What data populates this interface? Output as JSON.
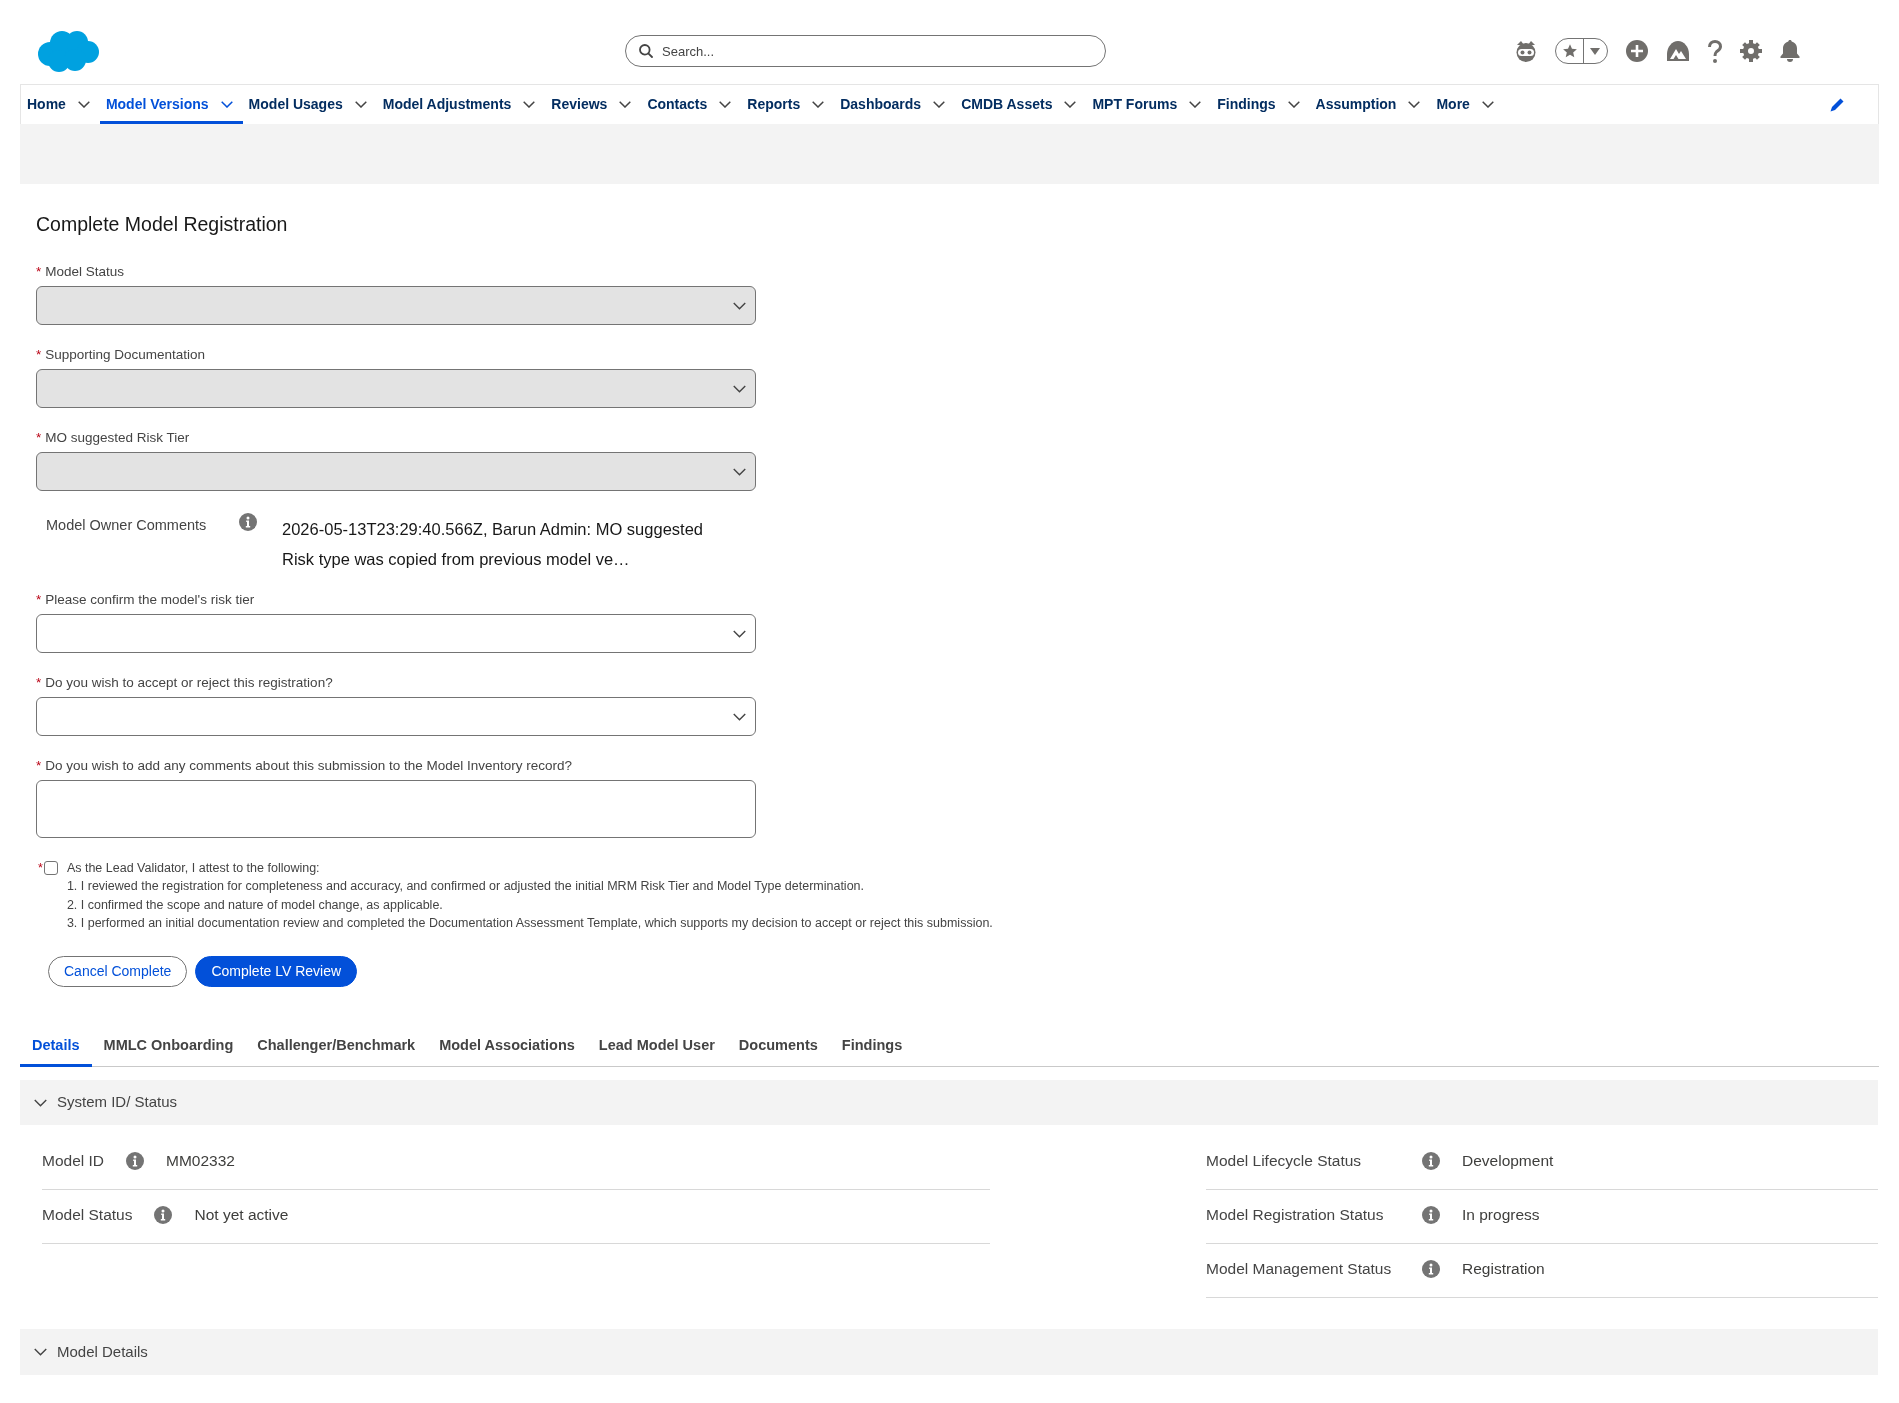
{
  "header": {
    "search": {
      "placeholder": "Search..."
    }
  },
  "nav": {
    "items": [
      {
        "label": "Home",
        "selected": false
      },
      {
        "label": "Model Versions",
        "selected": true
      },
      {
        "label": "Model Usages",
        "selected": false
      },
      {
        "label": "Model Adjustments",
        "selected": false
      },
      {
        "label": "Reviews",
        "selected": false
      },
      {
        "label": "Contacts",
        "selected": false
      },
      {
        "label": "Reports",
        "selected": false
      },
      {
        "label": "Dashboards",
        "selected": false
      },
      {
        "label": "CMDB Assets",
        "selected": false
      },
      {
        "label": "MPT Forums",
        "selected": false
      },
      {
        "label": "Findings",
        "selected": false
      },
      {
        "label": "Assumption",
        "selected": false
      },
      {
        "label": "More",
        "selected": false
      }
    ]
  },
  "form": {
    "title": "Complete Model Registration",
    "fields": [
      {
        "kind": "select",
        "required_mark": "*",
        "label": "Model Status",
        "disabled": true
      },
      {
        "kind": "select",
        "required_mark": "*",
        "label": "Supporting Documentation",
        "disabled": true
      },
      {
        "kind": "select",
        "required_mark": "*",
        "label": "MO suggested Risk Tier",
        "disabled": true
      },
      {
        "kind": "readonly",
        "label": "Model Owner Comments",
        "value": "2026-05-13T23:29:40.566Z, Barun Admin: MO suggested Risk type was copied from previous model ve…"
      },
      {
        "kind": "select",
        "required_mark": "*",
        "label": "Please confirm the model's risk tier",
        "disabled": false
      },
      {
        "kind": "select",
        "required_mark": "*",
        "label": "Do you wish to accept or reject this registration?",
        "disabled": false
      },
      {
        "kind": "textarea",
        "required_mark": "*",
        "label": "Do you wish to add any comments about this submission to the Model Inventory record?"
      }
    ],
    "attestation": {
      "required_mark": "*",
      "checked": false,
      "label": "As the Lead Validator, I attest to the following:",
      "items": [
        "1. I reviewed the registration for completeness and accuracy, and confirmed or adjusted the initial MRM Risk Tier and Model Type determination.",
        "2. I confirmed the scope and nature of model change, as applicable.",
        "3. I performed an initial documentation review and completed the Documentation Assessment Template, which supports my decision to accept or reject this submission."
      ]
    },
    "buttons": [
      {
        "label": "Cancel Complete",
        "kind": "outline"
      },
      {
        "label": "Complete LV Review",
        "kind": "brand"
      }
    ]
  },
  "tabs": [
    {
      "label": "Details",
      "selected": true
    },
    {
      "label": "MMLC Onboarding",
      "selected": false
    },
    {
      "label": "Challenger/Benchmark",
      "selected": false
    },
    {
      "label": "Model Associations",
      "selected": false
    },
    {
      "label": "Lead Model User",
      "selected": false
    },
    {
      "label": "Documents",
      "selected": false
    },
    {
      "label": "Findings",
      "selected": false
    }
  ],
  "sections": [
    {
      "title": "System ID/ Status",
      "expanded": true,
      "columns": [
        {
          "fields": [
            {
              "label": "Model ID",
              "value": "MM02332"
            },
            {
              "label": "Model Status",
              "value": "Not yet active"
            }
          ]
        },
        {
          "fields": [
            {
              "label": "Model Lifecycle Status",
              "value": "Development"
            },
            {
              "label": "Model Registration Status",
              "value": "In progress"
            },
            {
              "label": "Model Management Status",
              "value": "Registration"
            }
          ]
        }
      ]
    },
    {
      "title": "Model Details",
      "expanded": true
    }
  ]
}
